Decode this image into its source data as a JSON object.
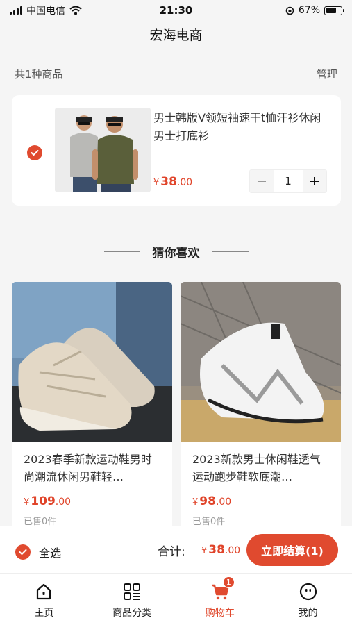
{
  "status_bar": {
    "carrier": "中国电信",
    "time": "21:30",
    "battery_percent": "67%",
    "battery_level": 0.67
  },
  "header": {
    "title": "宏海电商"
  },
  "cart": {
    "summary": "共1种商品",
    "manage_label": "管理",
    "items": [
      {
        "name": "男士韩版V领短袖速干t恤汗衫休闲男士打底衫",
        "price_currency": "¥",
        "price_int": "38",
        "price_dec": ".00",
        "quantity": "1",
        "checked": true
      }
    ]
  },
  "recommend": {
    "heading": "猜你喜欢",
    "items": [
      {
        "name": "2023春季新款运动鞋男时尚潮流休闲男鞋轻…",
        "price_currency": "¥",
        "price_int": "109",
        "price_dec": ".00",
        "sold": "已售0件"
      },
      {
        "name": "2023新款男士休闲鞋透气运动跑步鞋软底潮…",
        "price_currency": "¥",
        "price_int": "98",
        "price_dec": ".00",
        "sold": "已售0件"
      }
    ]
  },
  "checkout": {
    "select_all_label": "全选",
    "total_label": "合计:",
    "total_currency": "¥",
    "total_int": "38",
    "total_dec": ".00",
    "button_label": "立即结算(1)"
  },
  "tab_bar": {
    "items": [
      {
        "label": "主页",
        "icon": "home-icon"
      },
      {
        "label": "商品分类",
        "icon": "category-icon"
      },
      {
        "label": "购物车",
        "icon": "cart-icon",
        "badge": "1",
        "active": true
      },
      {
        "label": "我的",
        "icon": "profile-icon"
      }
    ]
  },
  "colors": {
    "accent": "#e04a2f",
    "background": "#f5f5f5"
  }
}
